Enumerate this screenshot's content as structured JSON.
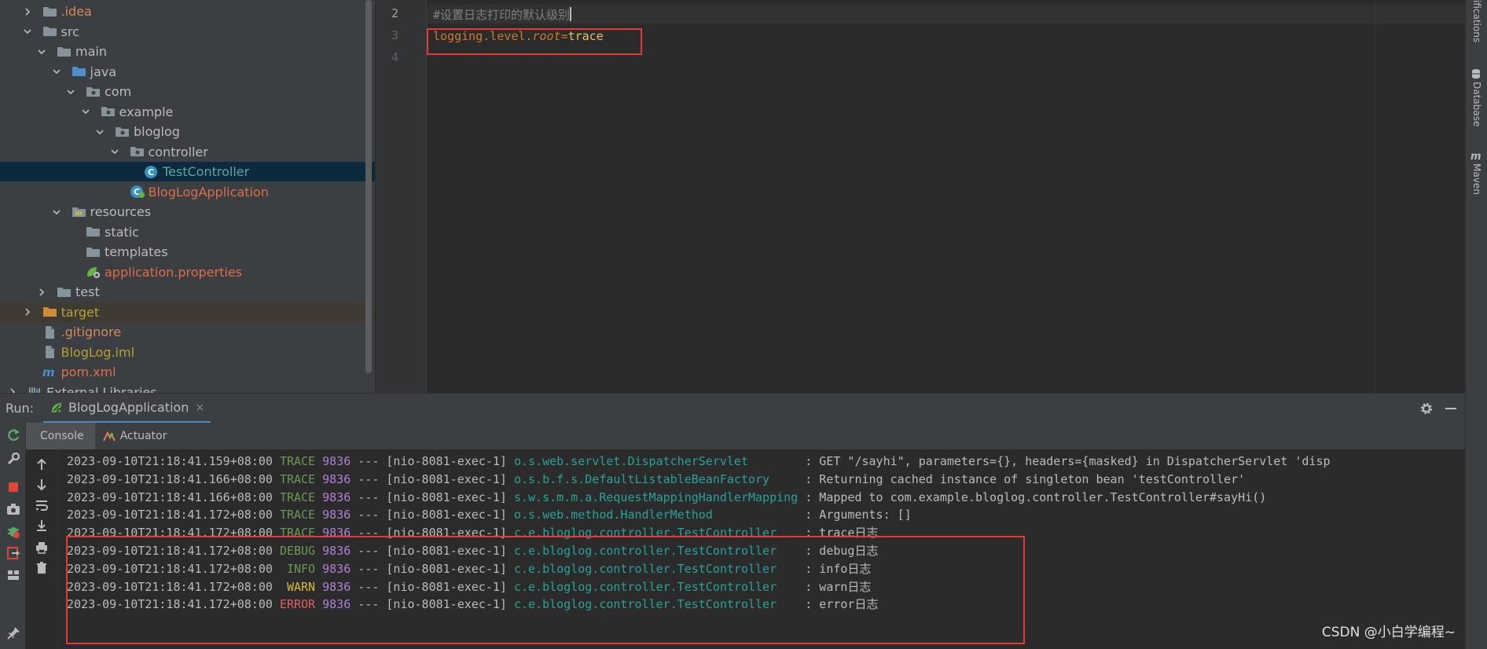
{
  "project_tree": [
    {
      "label": ".idea",
      "depth": 1,
      "chev": "right",
      "icon": "folder",
      "style": "orange"
    },
    {
      "label": "src",
      "depth": 1,
      "chev": "down",
      "icon": "folder",
      "style": "default"
    },
    {
      "label": "main",
      "depth": 2,
      "chev": "down",
      "icon": "folder",
      "style": "default"
    },
    {
      "label": "java",
      "depth": 3,
      "chev": "down",
      "icon": "folder-blue",
      "style": "default"
    },
    {
      "label": "com",
      "depth": 4,
      "chev": "down",
      "icon": "package",
      "style": "default"
    },
    {
      "label": "example",
      "depth": 5,
      "chev": "down",
      "icon": "package",
      "style": "default"
    },
    {
      "label": "bloglog",
      "depth": 6,
      "chev": "down",
      "icon": "package",
      "style": "default"
    },
    {
      "label": "controller",
      "depth": 7,
      "chev": "down",
      "icon": "package",
      "style": "default"
    },
    {
      "label": "TestController",
      "depth": 8,
      "chev": "none",
      "icon": "class",
      "style": "blue",
      "selected": true
    },
    {
      "label": "BlogLogApplication",
      "depth": 7,
      "chev": "none",
      "icon": "spring-class",
      "style": "red"
    },
    {
      "label": "resources",
      "depth": 3,
      "chev": "down",
      "icon": "resources",
      "style": "default"
    },
    {
      "label": "static",
      "depth": 4,
      "chev": "none",
      "icon": "folder",
      "style": "default"
    },
    {
      "label": "templates",
      "depth": 4,
      "chev": "none",
      "icon": "folder",
      "style": "default"
    },
    {
      "label": "application.properties",
      "depth": 4,
      "chev": "none",
      "icon": "spring-properties",
      "style": "red"
    },
    {
      "label": "test",
      "depth": 2,
      "chev": "right",
      "icon": "folder",
      "style": "default"
    },
    {
      "label": "target",
      "depth": 1,
      "chev": "right",
      "icon": "folder-orange",
      "style": "olive",
      "excluded": true
    },
    {
      "label": ".gitignore",
      "depth": 1,
      "chev": "none",
      "icon": "file",
      "style": "orange"
    },
    {
      "label": "BlogLog.iml",
      "depth": 1,
      "chev": "none",
      "icon": "file",
      "style": "olive"
    },
    {
      "label": "pom.xml",
      "depth": 1,
      "chev": "none",
      "icon": "maven",
      "style": "red"
    },
    {
      "label": "External Libraries",
      "depth": 0,
      "chev": "right",
      "icon": "libraries",
      "style": "default"
    }
  ],
  "editor": {
    "line_numbers": [
      "2",
      "3",
      "4"
    ],
    "comment": "#设置日志打印的默认级别",
    "key_prefix": "logging.level.",
    "key_italic": "root",
    "equals": "=",
    "value": "trace"
  },
  "right_strip": {
    "notifications": "ifications",
    "database": "Database",
    "maven": "Maven"
  },
  "run": {
    "label": "Run:",
    "tab_label": "BlogLogApplication",
    "tab_close": "×",
    "subtab_console": "Console",
    "subtab_actuator": "Actuator"
  },
  "console_lines": [
    {
      "ts": "2023-09-10T21:18:41.159+08:00",
      "level": "TRACE",
      "pid": "9836",
      "sep": "---",
      "thread": "[nio-8081-exec-1]",
      "logger": "o.s.web.servlet.DispatcherServlet       ",
      "msg": ": GET \"/sayhi\", parameters={}, headers={masked} in DispatcherServlet 'disp"
    },
    {
      "ts": "2023-09-10T21:18:41.166+08:00",
      "level": "TRACE",
      "pid": "9836",
      "sep": "---",
      "thread": "[nio-8081-exec-1]",
      "logger": "o.s.b.f.s.DefaultListableBeanFactory    ",
      "msg": ": Returning cached instance of singleton bean 'testController'"
    },
    {
      "ts": "2023-09-10T21:18:41.166+08:00",
      "level": "TRACE",
      "pid": "9836",
      "sep": "---",
      "thread": "[nio-8081-exec-1]",
      "logger": "s.w.s.m.m.a.RequestMappingHandlerMapping",
      "msg": ": Mapped to com.example.bloglog.controller.TestController#sayHi()"
    },
    {
      "ts": "2023-09-10T21:18:41.172+08:00",
      "level": "TRACE",
      "pid": "9836",
      "sep": "---",
      "thread": "[nio-8081-exec-1]",
      "logger": "o.s.web.method.HandlerMethod            ",
      "msg": ": Arguments: []"
    },
    {
      "ts": "2023-09-10T21:18:41.172+08:00",
      "level": "TRACE",
      "pid": "9836",
      "sep": "---",
      "thread": "[nio-8081-exec-1]",
      "logger": "c.e.bloglog.controller.TestController   ",
      "msg": ": trace日志"
    },
    {
      "ts": "2023-09-10T21:18:41.172+08:00",
      "level": "DEBUG",
      "pid": "9836",
      "sep": "---",
      "thread": "[nio-8081-exec-1]",
      "logger": "c.e.bloglog.controller.TestController   ",
      "msg": ": debug日志"
    },
    {
      "ts": "2023-09-10T21:18:41.172+08:00",
      "level": " INFO",
      "pid": "9836",
      "sep": "---",
      "thread": "[nio-8081-exec-1]",
      "logger": "c.e.bloglog.controller.TestController   ",
      "msg": ": info日志"
    },
    {
      "ts": "2023-09-10T21:18:41.172+08:00",
      "level": " WARN",
      "pid": "9836",
      "sep": "---",
      "thread": "[nio-8081-exec-1]",
      "logger": "c.e.bloglog.controller.TestController   ",
      "msg": ": warn日志"
    },
    {
      "ts": "2023-09-10T21:18:41.172+08:00",
      "level": "ERROR",
      "pid": "9836",
      "sep": "---",
      "thread": "[nio-8081-exec-1]",
      "logger": "c.e.bloglog.controller.TestController   ",
      "msg": ": error日志"
    }
  ],
  "watermark": "CSDN @小白学编程~",
  "colors": {
    "selection": "#0d293e",
    "highlight_box": "#e03a3a",
    "trace": "#6a9955",
    "warn": "#d7ba3f",
    "error": "#e06060",
    "logger": "#2aa198",
    "pid": "#b180d7"
  }
}
